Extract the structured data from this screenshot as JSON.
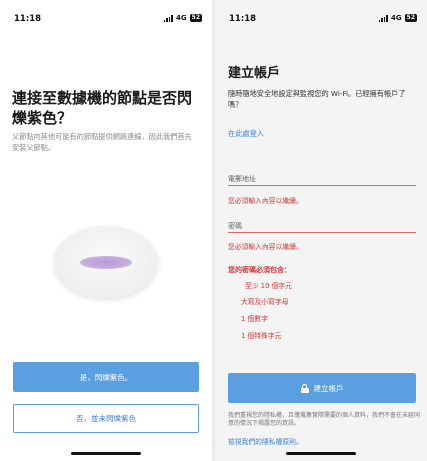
{
  "left": {
    "status": {
      "time": "11:18",
      "network": "4G",
      "battery": "52"
    },
    "title": "連接至數據機的節點是否閃爍紫色？",
    "description": "父節點向其他可能有的節點提供網路連線，因此我們首先安裝父節點。",
    "yes_button": "是，閃爍紫色。",
    "no_button": "否，並未閃爍紫色"
  },
  "right": {
    "status": {
      "time": "11:18",
      "network": "4G",
      "battery": "52"
    },
    "title": "建立帳戶",
    "description": "隨時隨地安全地設定與監視您的 Wi-Fi。已經擁有帳戶了嗎？",
    "login_link": "在此處登入",
    "email": {
      "label": "電郵地址",
      "error": "您必須輸入內容以繼續。"
    },
    "password": {
      "label": "密碼",
      "error": "您必須輸入內容以繼續。"
    },
    "password_rules": {
      "title": "您的密碼必須包含：",
      "items": [
        "至少 10 個字元",
        "大寫及小寫字母",
        "1 個數字",
        "1 個特殊字元"
      ]
    },
    "create_button": "建立帳戶",
    "privacy_text": "我們重視您的隱私權，且僅蒐集實際需要的個人資料，我們不會在未經同意的情況下揭露您的資訊。",
    "privacy_link": "檢視我們的隱私權原則。"
  },
  "colors": {
    "accent": "#5a9fe0",
    "error": "#d03a3a",
    "led": "#b79ad9"
  }
}
